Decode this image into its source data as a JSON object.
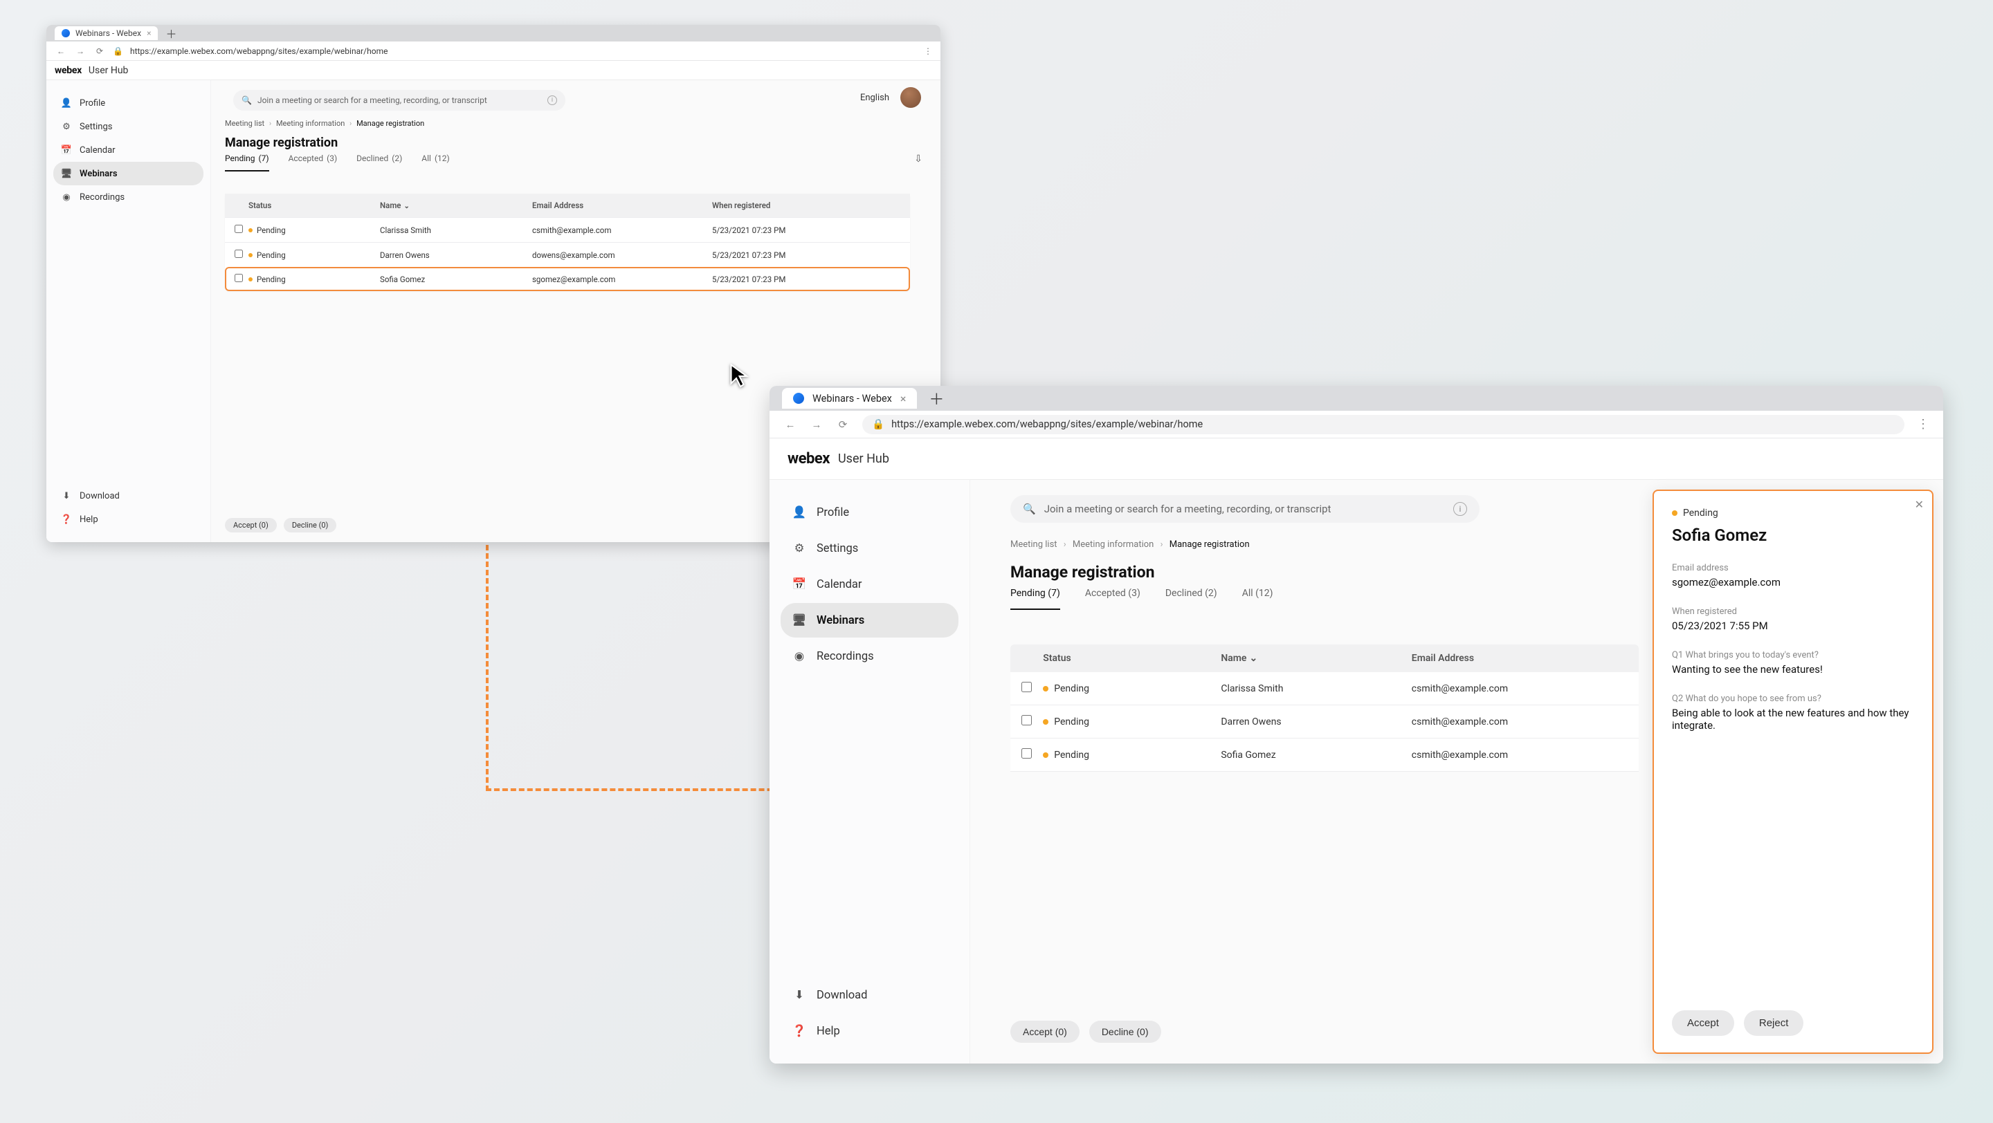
{
  "browser": {
    "tab_title": "Webinars - Webex",
    "url": "https://example.webex.com/webappng/sites/example/webinar/home"
  },
  "app": {
    "logo": "webex",
    "hub_label": "User Hub",
    "search_placeholder": "Join a meeting or search for a meeting, recording, or transcript",
    "language": "English"
  },
  "nav": {
    "profile": "Profile",
    "settings": "Settings",
    "calendar": "Calendar",
    "webinars": "Webinars",
    "recordings": "Recordings",
    "download": "Download",
    "help": "Help"
  },
  "breadcrumbs": {
    "a": "Meeting list",
    "b": "Meeting information",
    "c": "Manage registration"
  },
  "page": {
    "title": "Manage registration"
  },
  "regtabs": {
    "pending": {
      "label": "Pending",
      "count": "(7)"
    },
    "accepted": {
      "label": "Accepted",
      "count": "(3)"
    },
    "declined": {
      "label": "Declined",
      "count": "(2)"
    },
    "all": {
      "label": "All",
      "count": "(12)"
    }
  },
  "columns": {
    "status": "Status",
    "name": "Name",
    "email": "Email Address",
    "when": "When registered"
  },
  "small_rows": [
    {
      "status": "Pending",
      "name": "Clarissa Smith",
      "email": "csmith@example.com",
      "when": "5/23/2021  07:23 PM"
    },
    {
      "status": "Pending",
      "name": "Darren Owens",
      "email": "dowens@example.com",
      "when": "5/23/2021  07:23 PM"
    },
    {
      "status": "Pending",
      "name": "Sofia Gomez",
      "email": "sgomez@example.com",
      "when": "5/23/2021  07:23 PM"
    }
  ],
  "large_rows": [
    {
      "status": "Pending",
      "name": "Clarissa Smith",
      "email": "csmith@example.com"
    },
    {
      "status": "Pending",
      "name": "Darren Owens",
      "email": "csmith@example.com"
    },
    {
      "status": "Pending",
      "name": "Sofia Gomez",
      "email": "csmith@example.com"
    }
  ],
  "footer": {
    "accept": "Accept (0)",
    "decline": "Decline (0)"
  },
  "detail": {
    "status": "Pending",
    "name": "Sofia Gomez",
    "email_label": "Email address",
    "email": "sgomez@example.com",
    "when_label": "When registered",
    "when": "05/23/2021 7:55 PM",
    "q1_label": "Q1 What brings you to today's event?",
    "q1_answer": "Wanting to see the new features!",
    "q2_label": "Q2 What do you hope to see from us?",
    "q2_answer": "Being able to look at the new features and how they integrate.",
    "accept": "Accept",
    "reject": "Reject"
  }
}
